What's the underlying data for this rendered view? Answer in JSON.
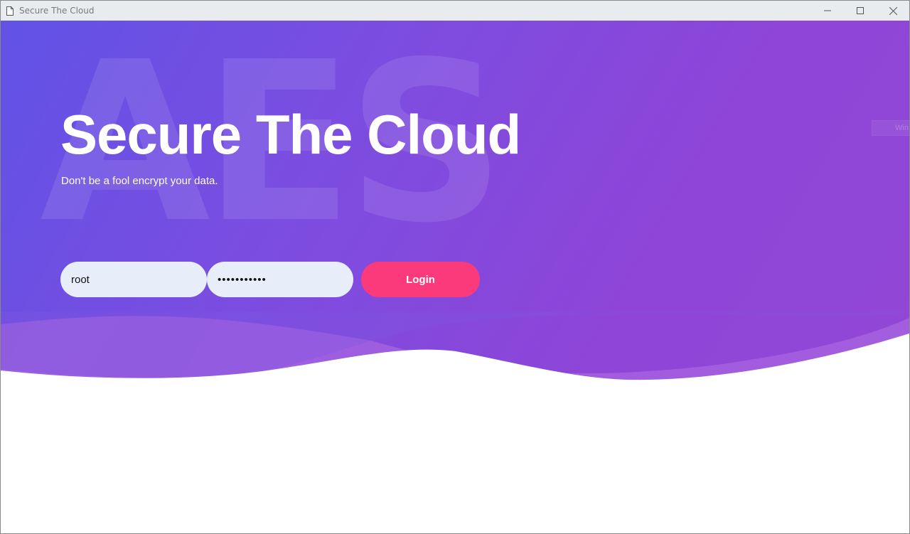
{
  "window": {
    "title": "Secure The Cloud",
    "controls": {
      "minimize": "minimize-icon",
      "maximize": "maximize-icon",
      "close": "close-icon"
    }
  },
  "hero": {
    "watermark": "AES",
    "headline": "Secure The Cloud",
    "subline": "Don't be a fool encrypt your data.",
    "ghost_text": "Win"
  },
  "login": {
    "username_value": "root",
    "password_value": "•••••••••••",
    "button_label": "Login"
  },
  "colors": {
    "gradient_start": "#6152e6",
    "gradient_end": "#9247d6",
    "button": "#fb3a7c",
    "field_bg": "#e8eef9"
  }
}
